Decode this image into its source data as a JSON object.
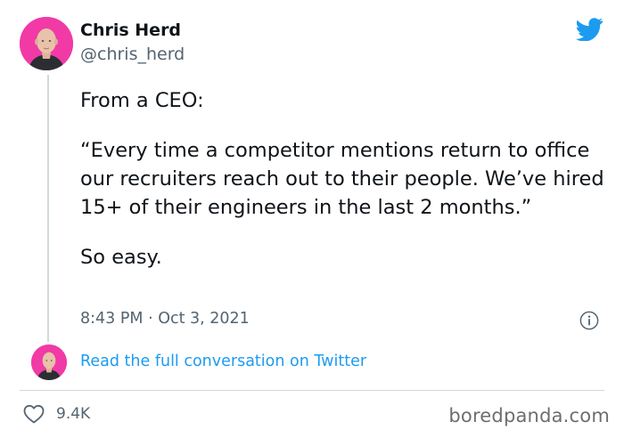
{
  "author": {
    "name": "Chris Herd",
    "handle": "@chris_herd",
    "avatar_color": "#f13aa6"
  },
  "tweet": {
    "paragraphs": [
      "From a CEO:",
      "“Every time a competitor mentions return to office our recruiters reach out to their people. We’ve hired 15+ of their engineers in the last 2 months.”",
      "So easy."
    ],
    "timestamp": "8:43 PM · Oct 3, 2021"
  },
  "actions": {
    "read_conversation": "Read the full conversation on Twitter",
    "like_count": "9.4K"
  },
  "icons": {
    "brand": "twitter-bird-icon",
    "info": "info-icon",
    "like": "heart-icon"
  },
  "colors": {
    "twitter_blue": "#1d9bf0",
    "text_primary": "#0f1419",
    "text_secondary": "#536471",
    "divider": "#cfd9de"
  },
  "watermark": "boredpanda.com"
}
